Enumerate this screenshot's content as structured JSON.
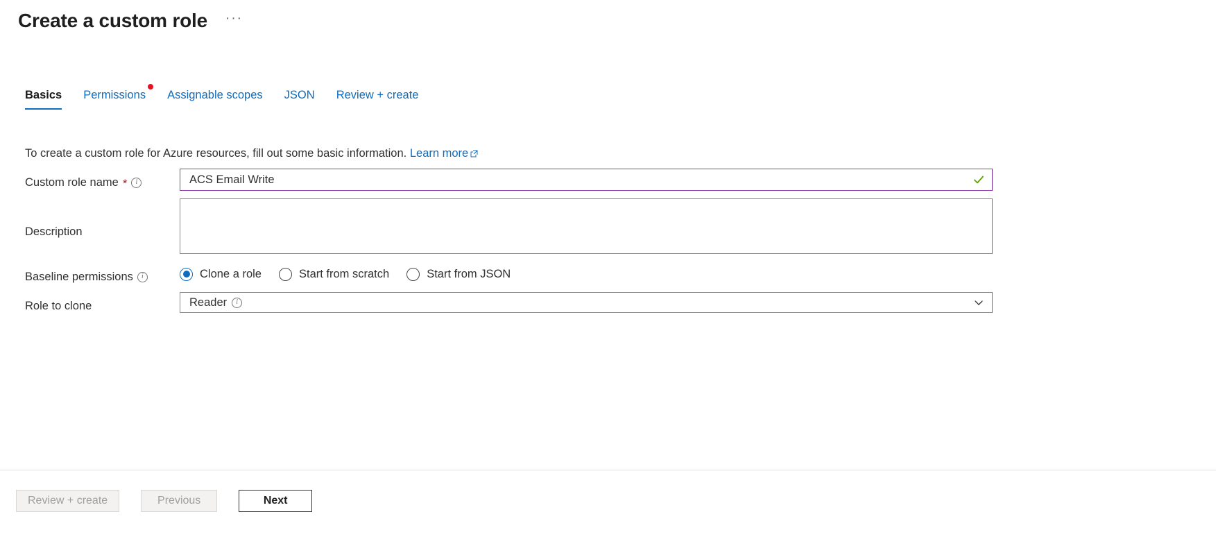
{
  "header": {
    "title": "Create a custom role",
    "more_menu": "···"
  },
  "tabs": [
    {
      "label": "Basics",
      "active": true,
      "badge": false
    },
    {
      "label": "Permissions",
      "active": false,
      "badge": true
    },
    {
      "label": "Assignable scopes",
      "active": false,
      "badge": false
    },
    {
      "label": "JSON",
      "active": false,
      "badge": false
    },
    {
      "label": "Review + create",
      "active": false,
      "badge": false
    }
  ],
  "intro": {
    "text": "To create a custom role for Azure resources, fill out some basic information.",
    "link_label": "Learn more",
    "link_icon": "external-link-icon"
  },
  "form": {
    "role_name": {
      "label": "Custom role name",
      "required_marker": "*",
      "info_icon": "info-icon",
      "value": "ACS Email Write",
      "placeholder": "",
      "valid_icon": "checkmark-icon",
      "border_color": "#8e3eab",
      "valid_color": "#5ba300"
    },
    "description": {
      "label": "Description",
      "value": "",
      "placeholder": ""
    },
    "baseline_permissions": {
      "label": "Baseline permissions",
      "info_icon": "info-icon",
      "options": [
        {
          "label": "Clone a role",
          "selected": true
        },
        {
          "label": "Start from scratch",
          "selected": false
        },
        {
          "label": "Start from JSON",
          "selected": false
        }
      ],
      "accent_color": "#0f6cbd"
    },
    "role_to_clone": {
      "label": "Role to clone",
      "value": "Reader",
      "info_icon": "info-icon",
      "chevron_icon": "chevron-down-icon"
    }
  },
  "footer": {
    "review_create": {
      "label": "Review + create",
      "enabled": false
    },
    "previous": {
      "label": "Previous",
      "enabled": false
    },
    "next": {
      "label": "Next",
      "enabled": true
    }
  },
  "colors": {
    "link": "#0f6cbd",
    "accent": "#0f6cbd",
    "badge_red": "#e81123",
    "required_red": "#a4262c",
    "valid_green": "#5ba300",
    "active_border": "#8e3eab"
  }
}
